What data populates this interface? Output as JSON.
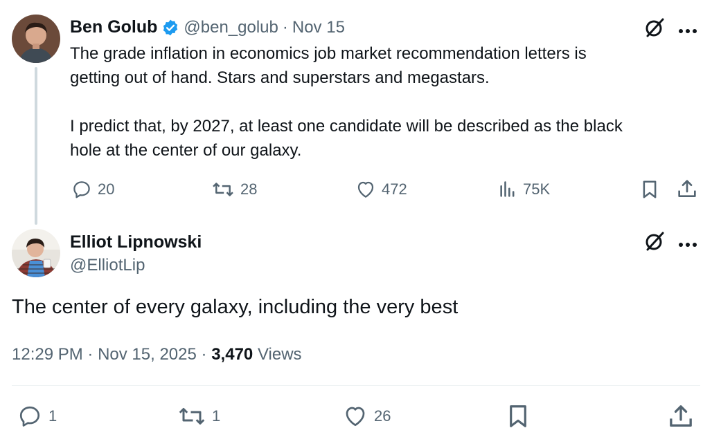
{
  "post": {
    "author_name": "Ben Golub",
    "handle": "@ben_golub",
    "separator": "·",
    "date": "Nov 15",
    "text_lines": [
      "The grade inflation in economics job market recommendation letters is",
      "getting out of hand. Stars and superstars and megastars.",
      "I predict that, by 2027, at least one candidate will be described as the black",
      "hole at the center of our galaxy."
    ],
    "replies": "20",
    "reposts": "28",
    "likes": "472",
    "views": "75K"
  },
  "reply": {
    "author_name": "Elliot Lipnowski",
    "handle": "@ElliotLip",
    "text": "The center of every galaxy, including the very best",
    "time": "12:29 PM",
    "separator": "·",
    "date": "Nov 15, 2025",
    "separator2": "·",
    "views_count": "3,470",
    "views_label": "Views",
    "replies": "1",
    "reposts": "1",
    "likes": "26"
  },
  "colors": {
    "verified": "#1d9bf0",
    "muted": "#536471",
    "text": "#0f1419",
    "thread_line": "#cfd9de"
  },
  "icons": [
    "verified-badge-icon",
    "grok-icon",
    "more-icon",
    "reply-icon",
    "repost-icon",
    "like-icon",
    "views-icon",
    "bookmark-icon",
    "share-icon"
  ]
}
